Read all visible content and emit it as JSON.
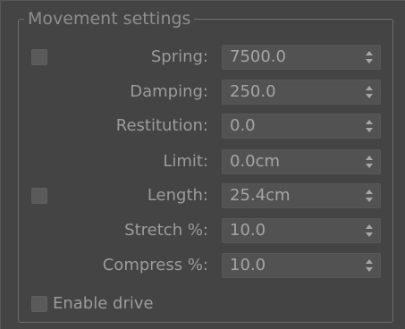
{
  "group": {
    "title": "Movement settings"
  },
  "fields": [
    {
      "label": "Spring:",
      "value": "7500.0",
      "has_checkbox": true,
      "checked": false
    },
    {
      "label": "Damping:",
      "value": "250.0",
      "has_checkbox": false
    },
    {
      "label": "Restitution:",
      "value": "0.0",
      "has_checkbox": false
    },
    {
      "label": "Limit:",
      "value": "0.0cm",
      "has_checkbox": false
    },
    {
      "label": "Length:",
      "value": "25.4cm",
      "has_checkbox": true,
      "checked": false
    },
    {
      "label": "Stretch %:",
      "value": "10.0",
      "has_checkbox": false
    },
    {
      "label": "Compress %:",
      "value": "10.0",
      "has_checkbox": false
    }
  ],
  "enable_drive": {
    "label": "Enable drive",
    "checked": false
  },
  "icons": {
    "spinner": "up-down-spinner-icon"
  },
  "colors": {
    "background": "#444444",
    "label_text": "#9c9c9c",
    "field_bg": "#525252"
  }
}
